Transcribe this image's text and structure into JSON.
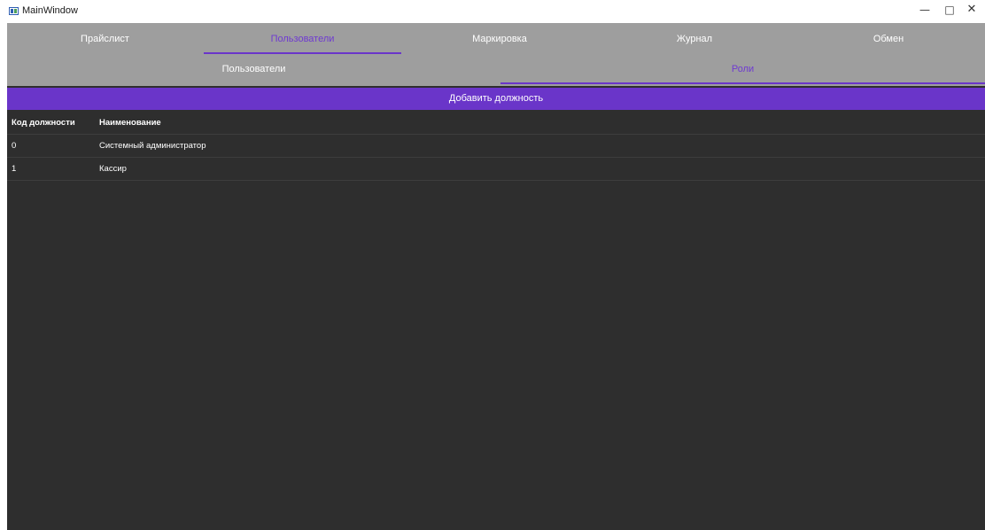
{
  "window": {
    "title": "MainWindow",
    "controls": {
      "minimize": "—",
      "maximize": "□",
      "close": "✕"
    }
  },
  "main_tabs": [
    {
      "label": "Прайслист",
      "active": false
    },
    {
      "label": "Пользователи",
      "active": true
    },
    {
      "label": "Маркировка",
      "active": false
    },
    {
      "label": "Журнал",
      "active": false
    },
    {
      "label": "Обмен",
      "active": false
    }
  ],
  "sub_tabs": [
    {
      "label": "Пользователи",
      "active": false
    },
    {
      "label": "Роли",
      "active": true
    }
  ],
  "toolbar": {
    "add_label": "Добавить должность"
  },
  "table": {
    "columns": [
      "Код должности",
      "Наименование"
    ],
    "rows": [
      [
        "0",
        "Системный администратор"
      ],
      [
        "1",
        "Кассир"
      ]
    ]
  },
  "colors": {
    "accent": "#6a35c9",
    "tab_bar": "#9e9e9e",
    "background": "#2e2e2e"
  }
}
